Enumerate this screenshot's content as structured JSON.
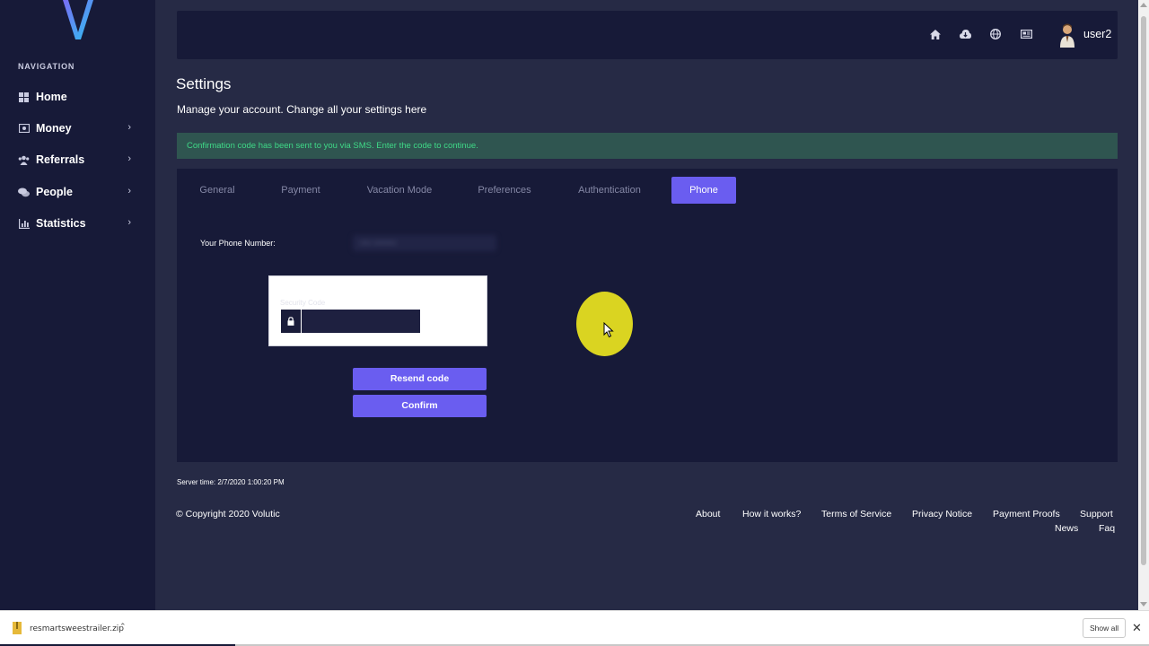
{
  "sidebar": {
    "heading": "NAVIGATION",
    "items": [
      {
        "label": "Home",
        "icon": "grid-icon"
      },
      {
        "label": "Money",
        "icon": "money-icon"
      },
      {
        "label": "Referrals",
        "icon": "users-icon"
      },
      {
        "label": "People",
        "icon": "chat-icon"
      },
      {
        "label": "Statistics",
        "icon": "bar-chart-icon"
      }
    ]
  },
  "header": {
    "icons": [
      "home-icon",
      "cloud-icon",
      "globe-icon",
      "news-icon"
    ],
    "username": "user2"
  },
  "page": {
    "title": "Settings",
    "subtitle": "Manage your account. Change all your settings here"
  },
  "alert": {
    "text": "Confirmation code has been sent to you via SMS. Enter the code to continue."
  },
  "tabs": [
    {
      "label": "General",
      "active": false
    },
    {
      "label": "Payment",
      "active": false
    },
    {
      "label": "Vacation Mode",
      "active": false
    },
    {
      "label": "Preferences",
      "active": false
    },
    {
      "label": "Authentication",
      "active": false
    },
    {
      "label": "Phone",
      "active": true
    }
  ],
  "phone_form": {
    "phone_label": "Your Phone Number:",
    "phone_value": "•••• ••••••••",
    "code_label": "Security Code",
    "code_value": "",
    "resend_label": "Resend code",
    "confirm_label": "Confirm"
  },
  "footer": {
    "server_time": "Server time: 2/7/2020 1:00:20 PM",
    "copyright": "© Copyright 2020 Volutic",
    "links": [
      "About",
      "How it works?",
      "Terms of Service",
      "Privacy Notice",
      "Payment Proofs",
      "Support",
      "News",
      "Faq"
    ]
  },
  "download_bar": {
    "file_name": "resmartsweestrailer.zip",
    "show_all": "Show all"
  },
  "colors": {
    "accent": "#6a5df0",
    "sidebar_bg": "#171a38",
    "page_bg": "#262a45",
    "alert_text": "#3fd987"
  }
}
